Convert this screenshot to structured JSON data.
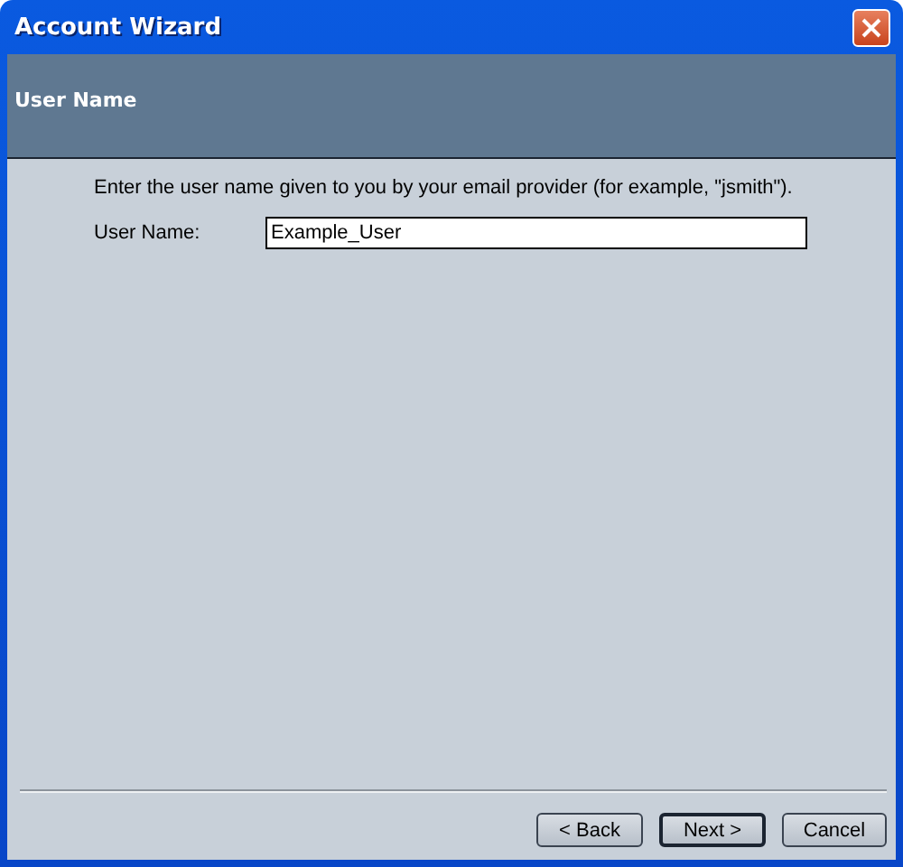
{
  "window": {
    "title": "Account Wizard"
  },
  "header": {
    "title": "User Name"
  },
  "instructions": "Enter the user name given to you by your email provider (for example, \"jsmith\").",
  "field": {
    "label": "User Name:",
    "value": "Example_User"
  },
  "buttons": [
    {
      "label": "< Back",
      "default": false
    },
    {
      "label": "Next >",
      "default": true
    },
    {
      "label": "Cancel",
      "default": false
    }
  ]
}
